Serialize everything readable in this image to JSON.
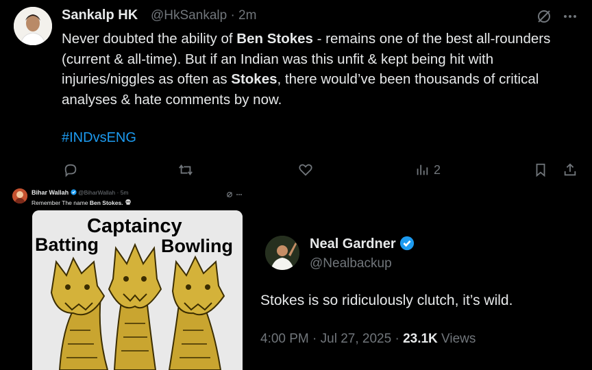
{
  "top_tweet": {
    "author_name": "Sankalp HK",
    "handle_time": "@HkSankalp · 2m",
    "text_parts": [
      "Never doubted the ability of ",
      "Ben Stokes",
      " - remains one of the best all-rounders (current & all-time). But if an Indian was this unfit & kept being hit with injuries/niggles as often as ",
      "Stokes",
      ", there would’ve been thousands of critical analyses & hate comments by now."
    ],
    "hashtag": "#INDvsENG",
    "views_count": "2",
    "icons": [
      "grok-icon",
      "more-icon",
      "reply-icon",
      "retweet-icon",
      "like-icon",
      "views-icon",
      "bookmark-icon",
      "share-icon"
    ]
  },
  "left_tweet": {
    "author_name": "Bihar Wallah",
    "handle_time": "@BiharWallah · 5m",
    "text_prefix": "Remember The name ",
    "text_bold": "Ben Stokes.",
    "meme_labels": {
      "top": "Captaincy",
      "left": "Batting",
      "right": "Bowling"
    }
  },
  "right_tweet": {
    "author_name": "Neal Gardner",
    "handle": "@Nealbackup",
    "text": "Stokes is so ridiculously clutch, it’s wild.",
    "timestamp": "4:00 PM · Jul 27, 2025 · ",
    "views_count": "23.1K",
    "views_label": " Views",
    "verified_color": "#1d9bf0"
  },
  "colors": {
    "background": "#000000",
    "text_primary": "#e7e9ea",
    "text_secondary": "#71767b",
    "link": "#1d9bf0",
    "hydra_gold": "#c9a530"
  }
}
